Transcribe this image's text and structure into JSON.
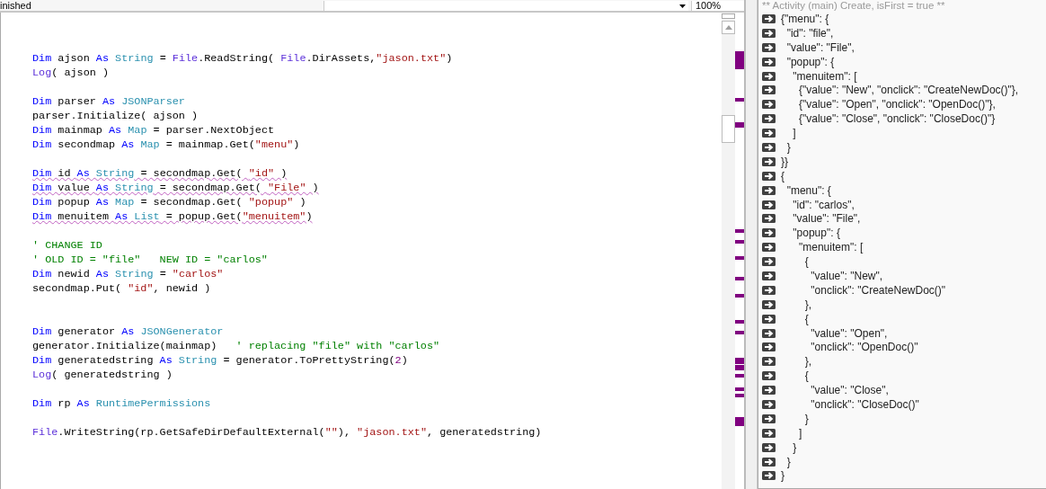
{
  "toolbar": {
    "status": "inished",
    "zoom": "100%"
  },
  "editor": {
    "lines": [
      {
        "kind": "blank"
      },
      {
        "kind": "code",
        "squiggly": false,
        "tokens": [
          {
            "kind": "keyword",
            "text": "Dim"
          },
          {
            "kind": "plain",
            "text": " ajson "
          },
          {
            "kind": "keyword",
            "text": "As"
          },
          {
            "kind": "type",
            "text": " String"
          },
          {
            "kind": "plain",
            "text": " = "
          },
          {
            "kind": "builtin",
            "text": "File"
          },
          {
            "kind": "plain",
            "text": ".ReadString( "
          },
          {
            "kind": "builtin",
            "text": "File"
          },
          {
            "kind": "plain",
            "text": ".DirAssets,"
          },
          {
            "kind": "string",
            "text": "\"jason.txt\""
          },
          {
            "kind": "plain",
            "text": ")"
          }
        ]
      },
      {
        "kind": "code",
        "squiggly": false,
        "tokens": [
          {
            "kind": "builtin",
            "text": "Log"
          },
          {
            "kind": "plain",
            "text": "( ajson )"
          }
        ]
      },
      {
        "kind": "blank"
      },
      {
        "kind": "code",
        "squiggly": false,
        "tokens": [
          {
            "kind": "keyword",
            "text": "Dim"
          },
          {
            "kind": "plain",
            "text": " parser "
          },
          {
            "kind": "keyword",
            "text": "As"
          },
          {
            "kind": "type",
            "text": " JSONParser"
          }
        ]
      },
      {
        "kind": "code",
        "squiggly": false,
        "tokens": [
          {
            "kind": "plain",
            "text": "parser.Initialize( ajson )"
          }
        ]
      },
      {
        "kind": "code",
        "squiggly": false,
        "tokens": [
          {
            "kind": "keyword",
            "text": "Dim"
          },
          {
            "kind": "plain",
            "text": " mainmap "
          },
          {
            "kind": "keyword",
            "text": "As"
          },
          {
            "kind": "type",
            "text": " Map"
          },
          {
            "kind": "plain",
            "text": " = parser.NextObject"
          }
        ]
      },
      {
        "kind": "code",
        "squiggly": false,
        "tokens": [
          {
            "kind": "keyword",
            "text": "Dim"
          },
          {
            "kind": "plain",
            "text": " secondmap "
          },
          {
            "kind": "keyword",
            "text": "As"
          },
          {
            "kind": "type",
            "text": " Map"
          },
          {
            "kind": "plain",
            "text": " = mainmap.Get("
          },
          {
            "kind": "string",
            "text": "\"menu\""
          },
          {
            "kind": "plain",
            "text": ")"
          }
        ]
      },
      {
        "kind": "blank"
      },
      {
        "kind": "code",
        "squiggly": true,
        "tokens": [
          {
            "kind": "keyword",
            "text": "Dim"
          },
          {
            "kind": "plain",
            "text": " id "
          },
          {
            "kind": "keyword",
            "text": "As"
          },
          {
            "kind": "type",
            "text": " String"
          },
          {
            "kind": "plain",
            "text": " = secondmap.Get( "
          },
          {
            "kind": "string",
            "text": "\"id\""
          },
          {
            "kind": "plain",
            "text": " )"
          }
        ]
      },
      {
        "kind": "code",
        "squiggly": true,
        "tokens": [
          {
            "kind": "keyword",
            "text": "Dim"
          },
          {
            "kind": "plain",
            "text": " value "
          },
          {
            "kind": "keyword",
            "text": "As"
          },
          {
            "kind": "type",
            "text": " String"
          },
          {
            "kind": "plain",
            "text": " = secondmap.Get( "
          },
          {
            "kind": "string",
            "text": "\"File\""
          },
          {
            "kind": "plain",
            "text": " )"
          }
        ]
      },
      {
        "kind": "code",
        "squiggly": false,
        "tokens": [
          {
            "kind": "keyword",
            "text": "Dim"
          },
          {
            "kind": "plain",
            "text": " popup "
          },
          {
            "kind": "keyword",
            "text": "As"
          },
          {
            "kind": "type",
            "text": " Map"
          },
          {
            "kind": "plain",
            "text": " = secondmap.Get( "
          },
          {
            "kind": "string",
            "text": "\"popup\""
          },
          {
            "kind": "plain",
            "text": " )"
          }
        ]
      },
      {
        "kind": "code",
        "squiggly": true,
        "tokens": [
          {
            "kind": "keyword",
            "text": "Dim"
          },
          {
            "kind": "plain",
            "text": " menuitem "
          },
          {
            "kind": "keyword",
            "text": "As"
          },
          {
            "kind": "type",
            "text": " List"
          },
          {
            "kind": "plain",
            "text": " = popup.Get("
          },
          {
            "kind": "string",
            "text": "\"menuitem\""
          },
          {
            "kind": "plain",
            "text": ")"
          }
        ]
      },
      {
        "kind": "blank"
      },
      {
        "kind": "code",
        "squiggly": false,
        "tokens": [
          {
            "kind": "comment",
            "text": "' CHANGE ID"
          }
        ]
      },
      {
        "kind": "code",
        "squiggly": false,
        "tokens": [
          {
            "kind": "comment",
            "text": "' OLD ID = \"file\"   NEW ID = \"carlos\""
          }
        ]
      },
      {
        "kind": "code",
        "squiggly": false,
        "tokens": [
          {
            "kind": "keyword",
            "text": "Dim"
          },
          {
            "kind": "plain",
            "text": " newid "
          },
          {
            "kind": "keyword",
            "text": "As"
          },
          {
            "kind": "type",
            "text": " String"
          },
          {
            "kind": "plain",
            "text": " = "
          },
          {
            "kind": "string",
            "text": "\"carlos\""
          }
        ]
      },
      {
        "kind": "code",
        "squiggly": false,
        "tokens": [
          {
            "kind": "plain",
            "text": "secondmap.Put( "
          },
          {
            "kind": "string",
            "text": "\"id\""
          },
          {
            "kind": "plain",
            "text": ", newid )"
          }
        ]
      },
      {
        "kind": "blank"
      },
      {
        "kind": "blank"
      },
      {
        "kind": "code",
        "squiggly": false,
        "tokens": [
          {
            "kind": "keyword",
            "text": "Dim"
          },
          {
            "kind": "plain",
            "text": " generator "
          },
          {
            "kind": "keyword",
            "text": "As"
          },
          {
            "kind": "type",
            "text": " JSONGenerator"
          }
        ]
      },
      {
        "kind": "code",
        "squiggly": false,
        "tokens": [
          {
            "kind": "plain",
            "text": "generator.Initialize(mainmap)   "
          },
          {
            "kind": "comment",
            "text": "' replacing \"file\" with \"carlos\""
          }
        ]
      },
      {
        "kind": "code",
        "squiggly": false,
        "tokens": [
          {
            "kind": "keyword",
            "text": "Dim"
          },
          {
            "kind": "plain",
            "text": " generatedstring "
          },
          {
            "kind": "keyword",
            "text": "As"
          },
          {
            "kind": "type",
            "text": " String"
          },
          {
            "kind": "plain",
            "text": " = generator.ToPrettyString("
          },
          {
            "kind": "number",
            "text": "2"
          },
          {
            "kind": "plain",
            "text": ")"
          }
        ]
      },
      {
        "kind": "code",
        "squiggly": false,
        "tokens": [
          {
            "kind": "builtin",
            "text": "Log"
          },
          {
            "kind": "plain",
            "text": "( generatedstring )"
          }
        ]
      },
      {
        "kind": "blank"
      },
      {
        "kind": "code",
        "squiggly": false,
        "tokens": [
          {
            "kind": "keyword",
            "text": "Dim"
          },
          {
            "kind": "plain",
            "text": " rp "
          },
          {
            "kind": "keyword",
            "text": "As"
          },
          {
            "kind": "type",
            "text": " RuntimePermissions"
          }
        ]
      },
      {
        "kind": "blank"
      },
      {
        "kind": "code",
        "squiggly": false,
        "tokens": [
          {
            "kind": "builtin",
            "text": "File"
          },
          {
            "kind": "plain",
            "text": ".WriteString(rp.GetSafeDirDefaultExternal("
          },
          {
            "kind": "string",
            "text": "\"\""
          },
          {
            "kind": "plain",
            "text": "), "
          },
          {
            "kind": "string",
            "text": "\"jason.txt\""
          },
          {
            "kind": "plain",
            "text": ", generatedstring)"
          }
        ]
      }
    ]
  },
  "log": {
    "header": "** Activity (main) Create, isFirst = true **",
    "lines": [
      "{\"menu\": {",
      "  \"id\": \"file\",",
      "  \"value\": \"File\",",
      "  \"popup\": {",
      "    \"menuitem\": [",
      "      {\"value\": \"New\", \"onclick\": \"CreateNewDoc()\"},",
      "      {\"value\": \"Open\", \"onclick\": \"OpenDoc()\"},",
      "      {\"value\": \"Close\", \"onclick\": \"CloseDoc()\"}",
      "    ]",
      "  }",
      "}}",
      "{",
      "  \"menu\": {",
      "    \"id\": \"carlos\",",
      "    \"value\": \"File\",",
      "    \"popup\": {",
      "      \"menuitem\": [",
      "        {",
      "          \"value\": \"New\",",
      "          \"onclick\": \"CreateNewDoc()\"",
      "        },",
      "        {",
      "          \"value\": \"Open\",",
      "          \"onclick\": \"OpenDoc()\"",
      "        },",
      "        {",
      "          \"value\": \"Close\",",
      "          \"onclick\": \"CloseDoc()\"",
      "        }",
      "      ]",
      "    }",
      "  }",
      "}"
    ]
  }
}
